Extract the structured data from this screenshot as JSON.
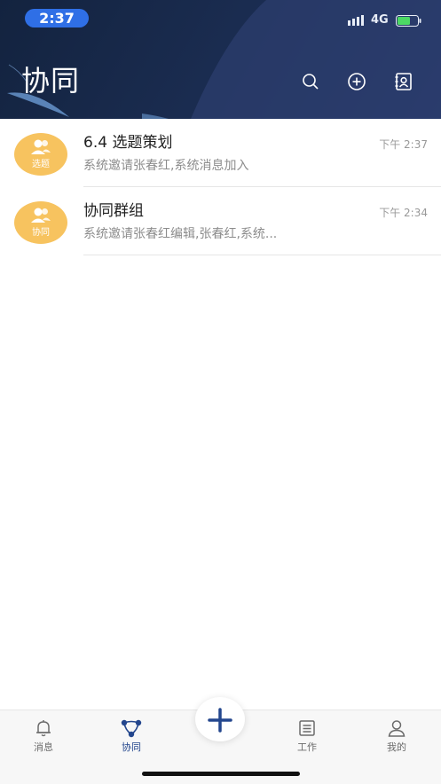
{
  "status_bar": {
    "time": "2:37",
    "network": "4G"
  },
  "header": {
    "title": "协同",
    "icons": {
      "search": "search-icon",
      "add": "add-circle-icon",
      "contacts": "contacts-icon"
    }
  },
  "conversations": [
    {
      "title": "6.4 选题策划",
      "subtitle": "系统邀请张春红,系统消息加入",
      "time": "下午 2:37",
      "avatar_label": "选题"
    },
    {
      "title": "协同群组",
      "subtitle": "系统邀请张春红编辑,张春红,系统...",
      "time": "下午 2:34",
      "avatar_label": "协同"
    }
  ],
  "tabbar": {
    "tabs": [
      {
        "label": "消息",
        "icon": "bell-icon"
      },
      {
        "label": "协同",
        "icon": "collaboration-icon"
      },
      {
        "label": "工作",
        "icon": "work-list-icon"
      },
      {
        "label": "我的",
        "icon": "profile-icon"
      }
    ],
    "active_tab": "协同",
    "fab_icon": "plus-icon"
  },
  "colors": {
    "header_bg": "#1b2d52",
    "avatar": "#f7c35f",
    "accent": "#23468d",
    "time_pill": "#2f6fe6"
  }
}
